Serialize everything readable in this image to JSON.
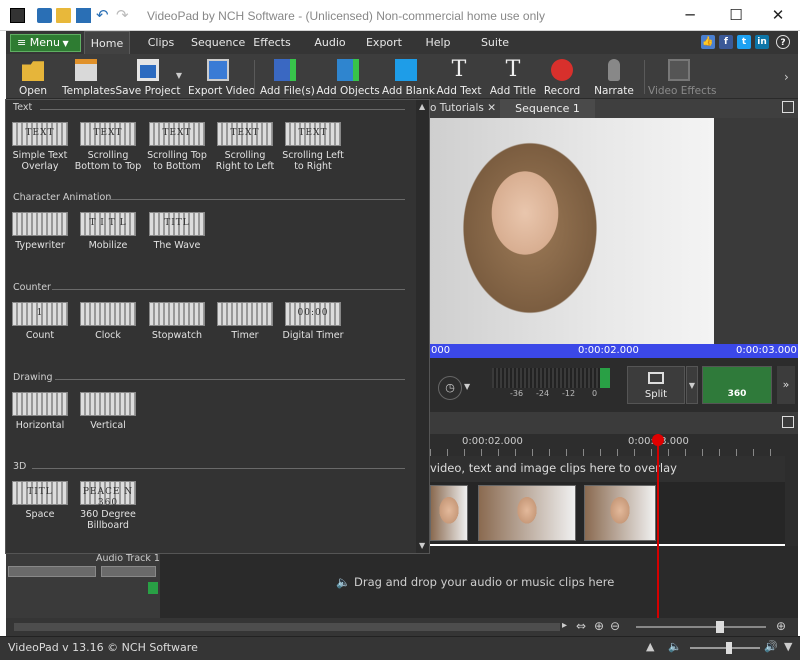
{
  "window": {
    "title": "VideoPad by NCH Software - (Unlicensed) Non-commercial home use only",
    "minimize": "─",
    "maximize": "☐",
    "close": "✕"
  },
  "menubar": {
    "menu_label": "Menu",
    "tabs": [
      "Home",
      "Clips",
      "Sequence",
      "Effects",
      "Audio",
      "Export",
      "Help",
      "Suite"
    ],
    "social": [
      "👍",
      "f",
      "t",
      "in",
      "?"
    ]
  },
  "toolbar": {
    "open": "Open",
    "templates": "Templates",
    "save_project": "Save Project",
    "export_video": "Export Video",
    "add_files": "Add File(s)",
    "add_objects": "Add Objects",
    "add_blank": "Add Blank",
    "add_text": "Add Text",
    "add_title": "Add Title",
    "record": "Record",
    "narrate": "Narrate",
    "video_effects": "Video Effects"
  },
  "panel": {
    "sections": [
      {
        "title": "Text",
        "items": [
          {
            "label": "Simple Text Overlay",
            "thumb": "TEXT"
          },
          {
            "label": "Scrolling Bottom to Top",
            "thumb": "TEXT"
          },
          {
            "label": "Scrolling Top to Bottom",
            "thumb": "TEXT"
          },
          {
            "label": "Scrolling Right to Left",
            "thumb": "TEXT"
          },
          {
            "label": "Scrolling Left to Right",
            "thumb": "TEXT"
          }
        ]
      },
      {
        "title": "Character Animation",
        "items": [
          {
            "label": "Typewriter",
            "thumb": ""
          },
          {
            "label": "Mobilize",
            "thumb": "T I T L"
          },
          {
            "label": "The Wave",
            "thumb": "TITL"
          }
        ]
      },
      {
        "title": "Counter",
        "items": [
          {
            "label": "Count",
            "thumb": "1"
          },
          {
            "label": "Clock",
            "thumb": ""
          },
          {
            "label": "Stopwatch",
            "thumb": ""
          },
          {
            "label": "Timer",
            "thumb": ""
          },
          {
            "label": "Digital Timer",
            "thumb": "00:00"
          }
        ]
      },
      {
        "title": "Drawing",
        "items": [
          {
            "label": "Horizontal",
            "thumb": ""
          },
          {
            "label": "Vertical",
            "thumb": ""
          }
        ]
      },
      {
        "title": "3D",
        "items": [
          {
            "label": "Space",
            "thumb": "TITL"
          },
          {
            "label": "360 Degree Billboard",
            "thumb": "PEACE N 360"
          }
        ]
      }
    ]
  },
  "preview": {
    "tab_tutorials": "o Tutorials",
    "tab_sequence": "Sequence 1",
    "ruler": [
      "000",
      "0:00:02.000",
      "0:00:03.000"
    ],
    "meter": [
      "-36",
      "-24",
      "-12",
      "0"
    ],
    "split": "Split",
    "vr": "360"
  },
  "timeline": {
    "ruler": [
      "0:00:02.000",
      "0:00:03.000"
    ],
    "overlay_hint": "video, text and image clips here to overlay",
    "audio_track": "Audio Track 1",
    "audio_hint": "Drag and drop your audio or music clips here"
  },
  "status": {
    "version": "VideoPad v 13.16 © NCH Software"
  }
}
